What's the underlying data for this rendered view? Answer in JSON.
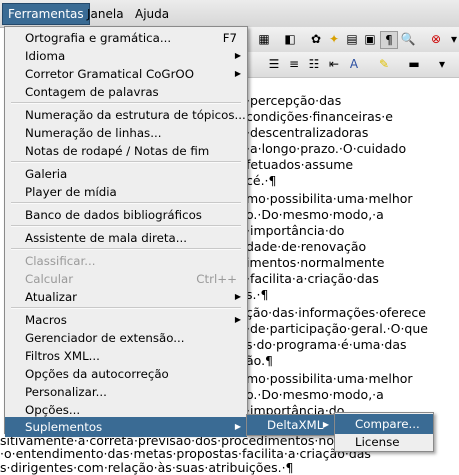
{
  "menubar": {
    "items": [
      {
        "label": "Ferramentas"
      },
      {
        "label": "Janela"
      },
      {
        "label": "Ajuda"
      }
    ]
  },
  "tools_menu": {
    "items": [
      {
        "label": "Ortografia e gramática...",
        "shortcut": "F7"
      },
      {
        "label": "Idioma"
      },
      {
        "label": "Corretor Gramatical CoGrOO"
      },
      {
        "label": "Contagem de palavras"
      },
      {
        "label": "Numeração da estrutura de tópicos..."
      },
      {
        "label": "Numeração de linhas..."
      },
      {
        "label": "Notas de rodapé / Notas de fim"
      },
      {
        "label": "Galeria"
      },
      {
        "label": "Player de mídia"
      },
      {
        "label": "Banco de dados bibliográficos"
      },
      {
        "label": "Assistente de mala direta..."
      },
      {
        "label": "Classificar..."
      },
      {
        "label": "Calcular",
        "shortcut": "Ctrl++"
      },
      {
        "label": "Atualizar"
      },
      {
        "label": "Macros"
      },
      {
        "label": "Gerenciador de extensão..."
      },
      {
        "label": "Filtros XML..."
      },
      {
        "label": "Opções da autocorreção"
      },
      {
        "label": "Personalizar..."
      },
      {
        "label": "Opções..."
      },
      {
        "label": "Suplementos"
      }
    ]
  },
  "suplementos_menu": {
    "items": [
      {
        "label": "DeltaXML"
      }
    ]
  },
  "deltaxml_menu": {
    "items": [
      {
        "label": "Compare..."
      },
      {
        "label": "License"
      }
    ]
  },
  "document": {
    "lines": [
      "·percepção·das",
      "condições·financeiras·e",
      "·descentralizadoras",
      "·a·longo·prazo.·O·cuidado",
      "fetuados·assume",
      "cé.·¶",
      "mo·possibilita·uma·melhor",
      "o.·Do·mesmo·modo,·a",
      "·importância·do",
      "dade·de·renovação",
      "imentos·normalmente",
      "·facilita·a·criação·das",
      "s.·¶",
      "ção·das·informações·oferece",
      "·de·participação·geral.·O·que",
      "s·do·programa·é·uma·das",
      "ão.¶",
      "mo·possibilita·uma·melhor",
      "o.·Do·mesmo·modo,·a",
      "·importância·do",
      "sitivamente·a·correta·previsão·dos·procedimentos·normalme",
      "·o·entendimento·das·metas·propostas·facilita·a·criação·das",
      "s·dirigentes·com·relação·às·suas·atribuições.·¶"
    ]
  }
}
